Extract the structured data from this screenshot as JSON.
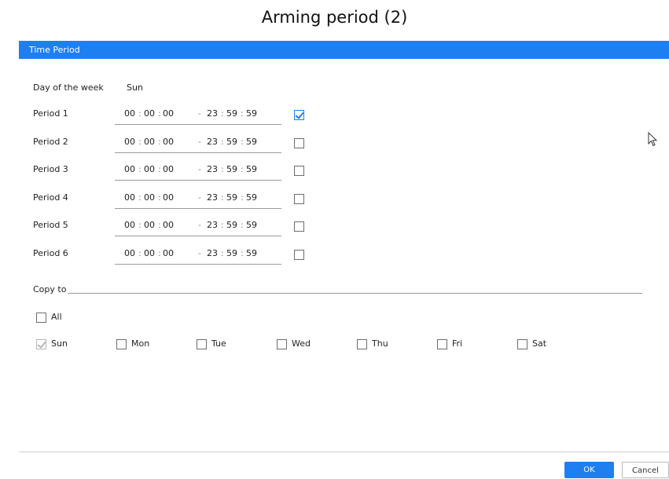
{
  "caption": "Arming period (2)",
  "dialog": {
    "title": "Time Period",
    "day_label": "Day of the week",
    "day_value": "Sun",
    "periods": [
      {
        "label": "Period 1",
        "start_h": "00",
        "start_m": "00",
        "start_s": "00",
        "end_h": "23",
        "end_m": "59",
        "end_s": "59",
        "enabled": true
      },
      {
        "label": "Period 2",
        "start_h": "00",
        "start_m": "00",
        "start_s": "00",
        "end_h": "23",
        "end_m": "59",
        "end_s": "59",
        "enabled": false
      },
      {
        "label": "Period 3",
        "start_h": "00",
        "start_m": "00",
        "start_s": "00",
        "end_h": "23",
        "end_m": "59",
        "end_s": "59",
        "enabled": false
      },
      {
        "label": "Period 4",
        "start_h": "00",
        "start_m": "00",
        "start_s": "00",
        "end_h": "23",
        "end_m": "59",
        "end_s": "59",
        "enabled": false
      },
      {
        "label": "Period 5",
        "start_h": "00",
        "start_m": "00",
        "start_s": "00",
        "end_h": "23",
        "end_m": "59",
        "end_s": "59",
        "enabled": false
      },
      {
        "label": "Period 6",
        "start_h": "00",
        "start_m": "00",
        "start_s": "00",
        "end_h": "23",
        "end_m": "59",
        "end_s": "59",
        "enabled": false
      }
    ],
    "copy_to_label": "Copy to",
    "all_label": "All",
    "all_checked": false,
    "days": [
      {
        "label": "Sun",
        "checked": true,
        "disabled": true
      },
      {
        "label": "Mon",
        "checked": false,
        "disabled": false
      },
      {
        "label": "Tue",
        "checked": false,
        "disabled": false
      },
      {
        "label": "Wed",
        "checked": false,
        "disabled": false
      },
      {
        "label": "Thu",
        "checked": false,
        "disabled": false
      },
      {
        "label": "Fri",
        "checked": false,
        "disabled": false
      },
      {
        "label": "Sat",
        "checked": false,
        "disabled": false
      }
    ],
    "ok_label": "OK",
    "cancel_label": "Cancel",
    "accent_color": "#1e7ff0"
  }
}
